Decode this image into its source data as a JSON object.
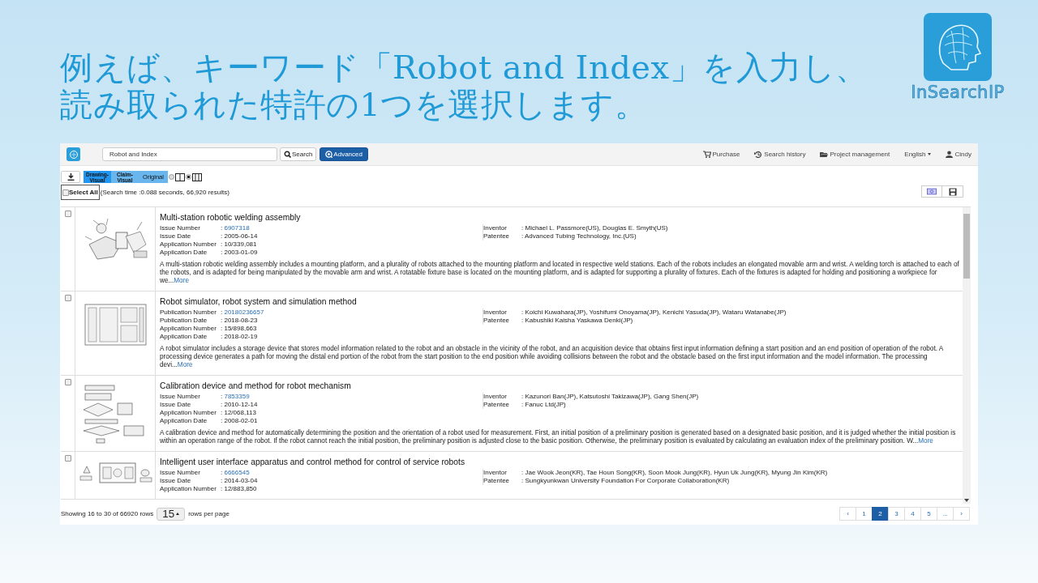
{
  "slide": {
    "heading": [
      "例えば、キーワード「Robot and Index」を入力し、",
      "読み取られた特許の1つを選択します。"
    ],
    "logo_text": "InSearchIP"
  },
  "navbar": {
    "search": {
      "value": "Robot and Index"
    },
    "buttons": [
      {
        "label": "Search",
        "kind": "search"
      },
      {
        "label": "Advanced",
        "kind": "advanced"
      }
    ],
    "links": [
      {
        "label": "Purchase",
        "kind": "cart"
      },
      {
        "label": "Search history",
        "kind": "history"
      },
      {
        "label": "Project management",
        "kind": "folder"
      },
      {
        "label": "English",
        "kind": "dropdown"
      },
      {
        "label": "Cindy",
        "kind": "user"
      }
    ]
  },
  "toolbar": {
    "view_tabs": [
      {
        "label": "Drawing-Visual",
        "selected": true
      },
      {
        "label": "Claim-Visual",
        "selected": false
      },
      {
        "label": "Original",
        "selected": false
      }
    ],
    "layouts": [
      {
        "kind": "two-column",
        "selected": false
      },
      {
        "kind": "three-column",
        "selected": true
      }
    ],
    "select_all": {
      "label": "Select All",
      "checked": false
    },
    "search_info": "(Search time :0.088 seconds, 66,920 results)"
  },
  "results": [
    {
      "checked": false,
      "title": "Multi-station robotic welding assembly",
      "fields": [
        {
          "label": "Issue Number",
          "separator": ":",
          "value": "6907318",
          "kind": "link"
        },
        {
          "label": "Issue Date",
          "separator": ":",
          "value": "2005-06-14",
          "kind": "text"
        },
        {
          "label": "Application Number",
          "separator": ":",
          "value": "10/339,081",
          "kind": "text"
        },
        {
          "label": "Application Date",
          "separator": ":",
          "value": "2003-01-09",
          "kind": "text"
        }
      ],
      "parties": [
        {
          "label": "Inventor",
          "separator": ":",
          "value": "Michael L. Passmore(US), Douglas E. Smyth(US)"
        },
        {
          "label": "Patentee",
          "separator": ":",
          "value": "Advanced Tubing Technology, Inc.(US)"
        }
      ],
      "abstract": "A multi-station robotic welding assembly includes a mounting platform, and a plurality of robots attached to the mounting platform and located in respective weld stations. Each of the robots includes an elongated movable arm and wrist. A welding torch is attached to each of the robots, and is adapted for being manipulated by the movable arm and wrist. A rotatable fixture base is located on the mounting platform, and is adapted for supporting a plurality of fixtures. Each of the fixtures is adapted for holding and positioning a workpiece for we...",
      "more": "More"
    },
    {
      "checked": false,
      "title": "Robot simulator, robot system and simulation method",
      "fields": [
        {
          "label": "Publication Number",
          "separator": ":",
          "value": "20180236657",
          "kind": "link"
        },
        {
          "label": "Publication Date",
          "separator": ":",
          "value": "2018-08-23",
          "kind": "text"
        },
        {
          "label": "Application Number",
          "separator": ":",
          "value": "15/898,663",
          "kind": "text"
        },
        {
          "label": "Application Date",
          "separator": ":",
          "value": "2018-02-19",
          "kind": "text"
        }
      ],
      "parties": [
        {
          "label": "Inventor",
          "separator": ":",
          "value": "Koichi Kuwahara(JP), Yoshifumi Onoyama(JP), Kenichi Yasuda(JP), Wataru Watanabe(JP)"
        },
        {
          "label": "Patentee",
          "separator": ":",
          "value": "Kabushiki Kaisha Yaskawa Denki(JP)"
        }
      ],
      "abstract": "A robot simulator includes a storage device that stores model information related to the robot and an obstacle in the vicinity of the robot, and an acquisition device that obtains first input information defining a start position and an end position of operation of the robot. A processing device generates a path for moving the distal end portion of the robot from the start position to the end position while avoiding collisions between the robot and the obstacle based on the first input information and the model information. The processing devi...",
      "more": "More"
    },
    {
      "checked": false,
      "title": "Calibration device and method for robot mechanism",
      "fields": [
        {
          "label": "Issue Number",
          "separator": ":",
          "value": "7853359",
          "kind": "link"
        },
        {
          "label": "Issue Date",
          "separator": ":",
          "value": "2010-12-14",
          "kind": "text"
        },
        {
          "label": "Application Number",
          "separator": ":",
          "value": "12/068,113",
          "kind": "text"
        },
        {
          "label": "Application Date",
          "separator": ":",
          "value": "2008-02-01",
          "kind": "text"
        }
      ],
      "parties": [
        {
          "label": "Inventor",
          "separator": ":",
          "value": "Kazunori Ban(JP), Katsutoshi Takizawa(JP), Gang Shen(JP)"
        },
        {
          "label": "Patentee",
          "separator": ":",
          "value": "Fanuc Ltd(JP)"
        }
      ],
      "abstract": "A calibration device and method for automatically determining the position and the orientation of a robot used for measurement. First, an initial position of a preliminary position is generated based on a designated basic position, and it is judged whether the initial position is within an operation range of the robot. If the robot cannot reach the initial position, the preliminary position is adjusted close to the basic position. Otherwise, the preliminary position is evaluated by calculating an evaluation index of the preliminary position. W...",
      "more": "More"
    },
    {
      "checked": false,
      "title": "Intelligent user interface apparatus and control method for control of service robots",
      "fields": [
        {
          "label": "Issue Number",
          "separator": ":",
          "value": "6666545",
          "kind": "link"
        },
        {
          "label": "Issue Date",
          "separator": ":",
          "value": "2014-03-04",
          "kind": "text"
        },
        {
          "label": "Application Number",
          "separator": ":",
          "value": "12/883,850",
          "kind": "text"
        }
      ],
      "parties": [
        {
          "label": "Inventor",
          "separator": ":",
          "value": "Jae Wook Jeon(KR), Tae Houn Song(KR), Soon Mook Jung(KR), Hyun Uk Jung(KR), Myung Jin Kim(KR)"
        },
        {
          "label": "Patentee",
          "separator": ":",
          "value": "Sungkyunkwan University Foundation For Corporate Collaboration(KR)"
        }
      ]
    }
  ],
  "footer": {
    "summary": "Showing 16 to 30 of 66920 rows",
    "page_size": "15",
    "page_size_label": "rows per page",
    "pages": [
      {
        "label": "‹",
        "selected": false
      },
      {
        "label": "1",
        "selected": false
      },
      {
        "label": "2",
        "selected": true
      },
      {
        "label": "3",
        "selected": false
      },
      {
        "label": "4",
        "selected": false
      },
      {
        "label": "5",
        "selected": false
      },
      {
        "label": "...",
        "selected": false
      },
      {
        "label": "›",
        "selected": false
      }
    ]
  }
}
